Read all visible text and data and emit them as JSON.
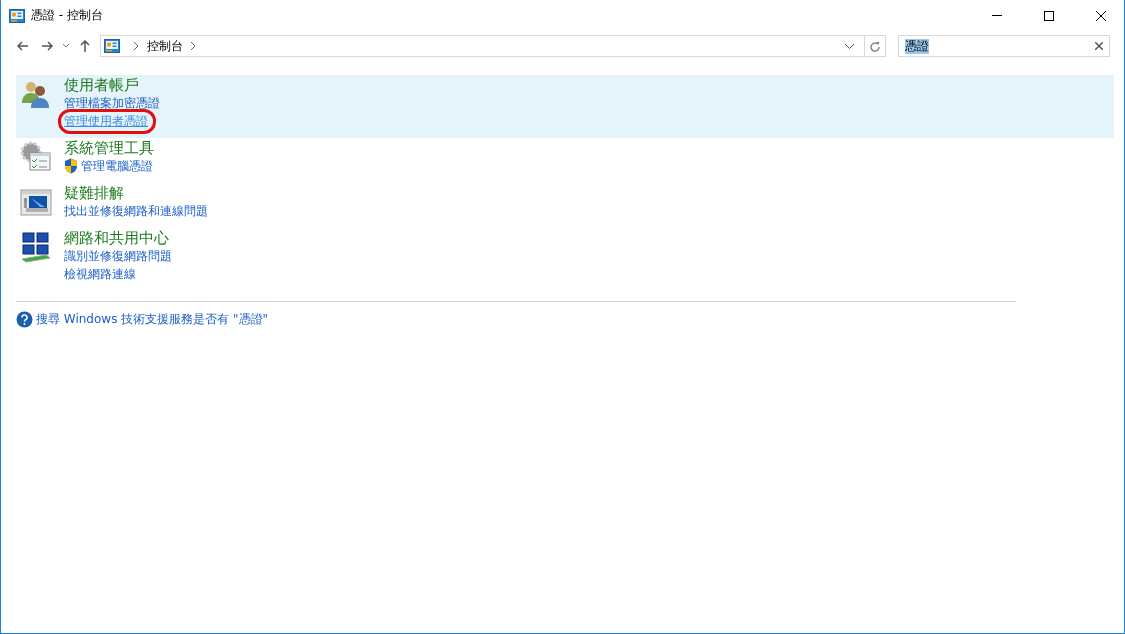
{
  "window": {
    "title": "憑證 - 控制台"
  },
  "address_bar": {
    "breadcrumbs": [
      "控制台"
    ]
  },
  "search": {
    "value": "憑證"
  },
  "results": [
    {
      "title": "使用者帳戶",
      "selected": true,
      "links": [
        {
          "label": "管理檔案加密憑證",
          "shield": false,
          "circled": false
        },
        {
          "label": "管理使用者憑證",
          "shield": false,
          "circled": true
        }
      ]
    },
    {
      "title": "系統管理工具",
      "selected": false,
      "links": [
        {
          "label": "管理電腦憑證",
          "shield": true,
          "circled": false
        }
      ]
    },
    {
      "title": "疑難排解",
      "selected": false,
      "links": [
        {
          "label": "找出並修復網路和連線問題",
          "shield": false,
          "circled": false
        }
      ]
    },
    {
      "title": "網路和共用中心",
      "selected": false,
      "links": [
        {
          "label": "識別並修復網路問題",
          "shield": false,
          "circled": false
        },
        {
          "label": "檢視網路連線",
          "shield": false,
          "circled": false
        }
      ]
    }
  ],
  "help_link": "搜尋 Windows 技術支援服務是否有 \"憑證\""
}
